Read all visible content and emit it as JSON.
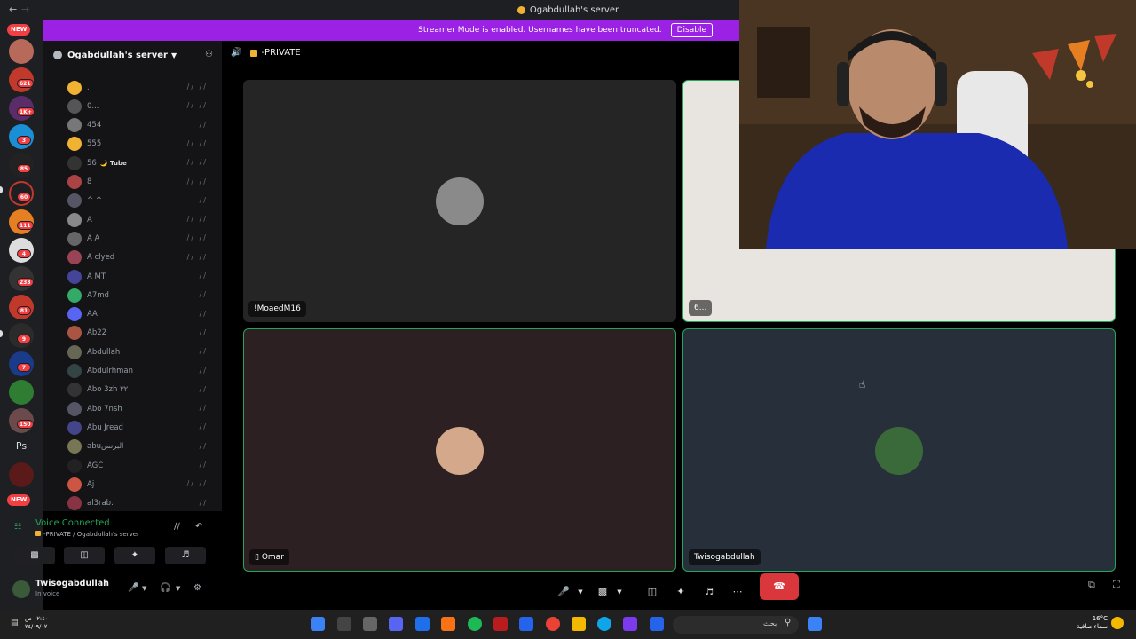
{
  "titlebar": {
    "title": "Ogabdullah's server"
  },
  "rail": {
    "new_top": "NEW",
    "new_bottom": "NEW",
    "badges": [
      "621",
      "1K+",
      "3",
      "85",
      "60",
      "111",
      "4",
      "233",
      "81",
      "9",
      "7",
      "150"
    ],
    "ps_label": "Ps"
  },
  "banner": {
    "text": "Streamer Mode is enabled. Usernames have been truncated.",
    "disable_label": "Disable",
    "color": "#9b22e5"
  },
  "sidebar": {
    "server_name": "Ogabdullah's server",
    "members": [
      {
        "name": ".",
        "muted": true,
        "deaf": true,
        "color": "#f0b232"
      },
      {
        "name": "0...",
        "muted": true,
        "deaf": true,
        "color": "#555"
      },
      {
        "name": "454",
        "muted": true,
        "deaf": false,
        "color": "#777"
      },
      {
        "name": "555",
        "muted": true,
        "deaf": true,
        "color": "#f0b232"
      },
      {
        "name": "56",
        "tag": "🌙 Tube",
        "muted": true,
        "deaf": true,
        "color": "#333"
      },
      {
        "name": "8",
        "muted": true,
        "deaf": true,
        "color": "#a44"
      },
      {
        "name": "^ ^",
        "muted": true,
        "deaf": false,
        "color": "#556"
      },
      {
        "name": "A",
        "muted": true,
        "deaf": true,
        "color": "#888"
      },
      {
        "name": "A A",
        "muted": true,
        "deaf": true,
        "color": "#666"
      },
      {
        "name": "A clyed",
        "muted": true,
        "deaf": true,
        "color": "#945"
      },
      {
        "name": "A MT",
        "muted": true,
        "deaf": false,
        "color": "#449"
      },
      {
        "name": "A7md",
        "muted": true,
        "deaf": false,
        "color": "#3a6"
      },
      {
        "name": "AA",
        "muted": true,
        "deaf": false,
        "color": "#5865f2"
      },
      {
        "name": "Ab22",
        "muted": true,
        "deaf": false,
        "color": "#a54"
      },
      {
        "name": "Abdullah",
        "muted": true,
        "deaf": false,
        "color": "#665"
      },
      {
        "name": "Abdulrhman",
        "muted": true,
        "deaf": false,
        "color": "#344"
      },
      {
        "name": "Abo 3zh ٣٢",
        "muted": true,
        "deaf": false,
        "color": "#333"
      },
      {
        "name": "Abo 7nsh",
        "muted": true,
        "deaf": false,
        "color": "#556"
      },
      {
        "name": "Abu Jread",
        "muted": true,
        "deaf": false,
        "color": "#448"
      },
      {
        "name": "abuالبرنس",
        "muted": true,
        "deaf": false,
        "color": "#775"
      },
      {
        "name": "AGC",
        "muted": true,
        "deaf": false,
        "color": "#222"
      },
      {
        "name": "Aj",
        "muted": true,
        "deaf": true,
        "color": "#c54"
      },
      {
        "name": "al3rab.",
        "muted": true,
        "deaf": false,
        "color": "#834"
      }
    ]
  },
  "voice": {
    "status": "Voice Connected",
    "location": "-PRIVATE / Ogabdullah's server",
    "color": "#23a55a"
  },
  "user": {
    "name": "Twisogabdullah",
    "status": "In voice"
  },
  "main": {
    "channel_name": "-PRIVATE",
    "tiles": [
      {
        "label": "!MoaedM16",
        "bg": "#252526",
        "avatar": "#8a8a8a"
      },
      {
        "label": "6...",
        "bg": "#e8e4e0",
        "avatar": ""
      },
      {
        "label": "Omar",
        "bg": "#2c2022",
        "avatar": "#d4a88a",
        "phone": true
      },
      {
        "label": "Twisogabdullah",
        "bg": "#27303a",
        "avatar": "#3b6a3a"
      }
    ],
    "hangup_color": "#da373c"
  },
  "taskbar": {
    "time": "٠٢:٤٠ ص",
    "date": "٢٤/٠٩/٠٢",
    "search_text": "بحث",
    "temperature": "16°C",
    "weather_text": "سماء صافية"
  }
}
